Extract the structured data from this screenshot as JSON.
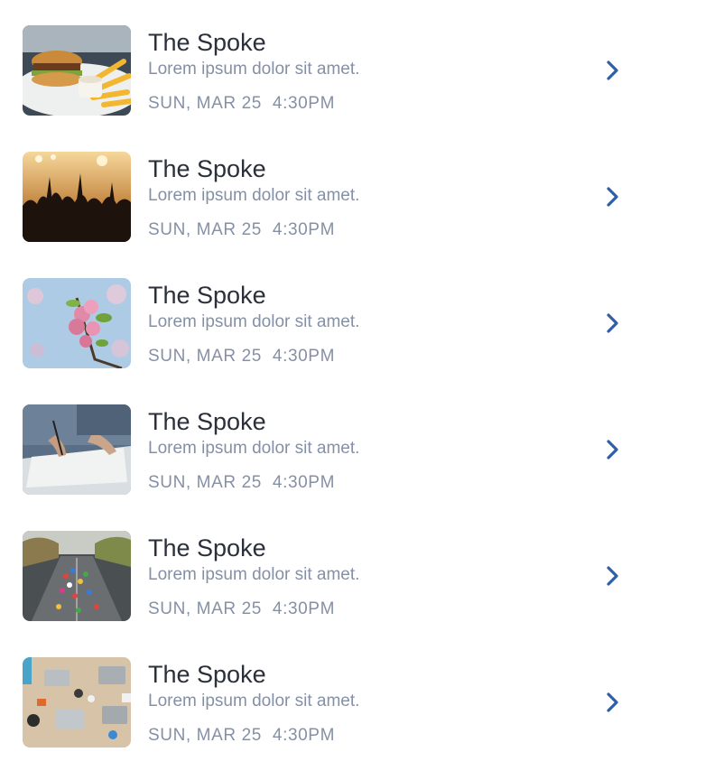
{
  "events": [
    {
      "image": "burger-and-fries-photo",
      "title": "The Spoke",
      "subtitle": "Lorem ipsum dolor sit amet.",
      "date": "SUN, MAR 25",
      "time": "4:30PM",
      "icon": "chevron-right-icon"
    },
    {
      "image": "concert-crowd-photo",
      "title": "The Spoke",
      "subtitle": "Lorem ipsum dolor sit amet.",
      "date": "SUN, MAR 25",
      "time": "4:30PM",
      "icon": "chevron-right-icon"
    },
    {
      "image": "cherry-blossom-photo",
      "title": "The Spoke",
      "subtitle": "Lorem ipsum dolor sit amet.",
      "date": "SUN, MAR 25",
      "time": "4:30PM",
      "icon": "chevron-right-icon"
    },
    {
      "image": "person-signing-document-photo",
      "title": "The Spoke",
      "subtitle": "Lorem ipsum dolor sit amet.",
      "date": "SUN, MAR 25",
      "time": "4:30PM",
      "icon": "chevron-right-icon"
    },
    {
      "image": "marathon-runners-photo",
      "title": "The Spoke",
      "subtitle": "Lorem ipsum dolor sit amet.",
      "date": "SUN, MAR 25",
      "time": "4:30PM",
      "icon": "chevron-right-icon"
    },
    {
      "image": "desk-with-laptops-photo",
      "title": "The Spoke",
      "subtitle": "Lorem ipsum dolor sit amet.",
      "date": "SUN, MAR 25",
      "time": "4:30PM",
      "icon": "chevron-right-icon"
    }
  ],
  "colors": {
    "title": "#2b2f3a",
    "secondary_text": "#8590a6",
    "chevron": "#2f5fa8",
    "background": "#ffffff"
  }
}
